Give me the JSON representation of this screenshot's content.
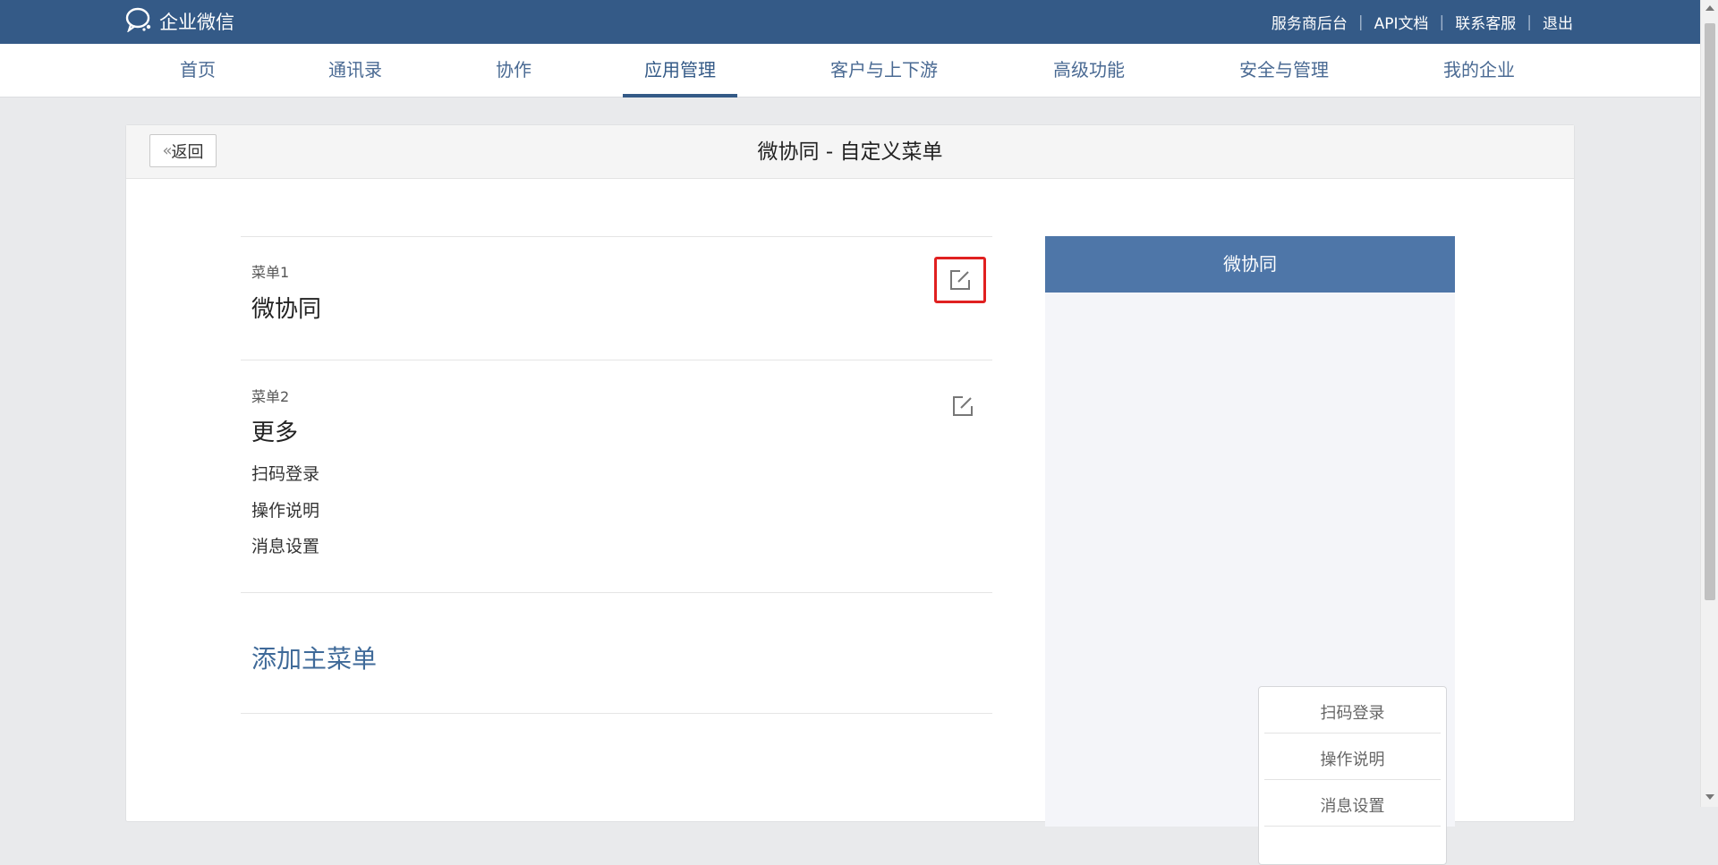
{
  "header": {
    "logo_text": "企业微信",
    "logo_icon": "wecom-chat-icon",
    "links": [
      "服务商后台",
      "API文档",
      "联系客服",
      "退出"
    ]
  },
  "nav": {
    "items": [
      "首页",
      "通讯录",
      "协作",
      "应用管理",
      "客户与上下游",
      "高级功能",
      "安全与管理",
      "我的企业"
    ],
    "active": "应用管理"
  },
  "page": {
    "back_label": "返回",
    "title": "微协同 - 自定义菜单"
  },
  "menus": [
    {
      "label": "菜单1",
      "name": "微协同",
      "sub_items": []
    },
    {
      "label": "菜单2",
      "name": "更多",
      "sub_items": [
        "扫码登录",
        "操作说明",
        "消息设置"
      ]
    }
  ],
  "add_menu_label": "添加主菜单",
  "preview": {
    "header_title": "微协同",
    "popup_items": [
      "扫码登录",
      "操作说明",
      "消息设置"
    ]
  },
  "colors": {
    "topbar": "#345a87",
    "preview_header": "#4e76a8",
    "highlight": "#e02020",
    "link": "#3f6a99"
  }
}
